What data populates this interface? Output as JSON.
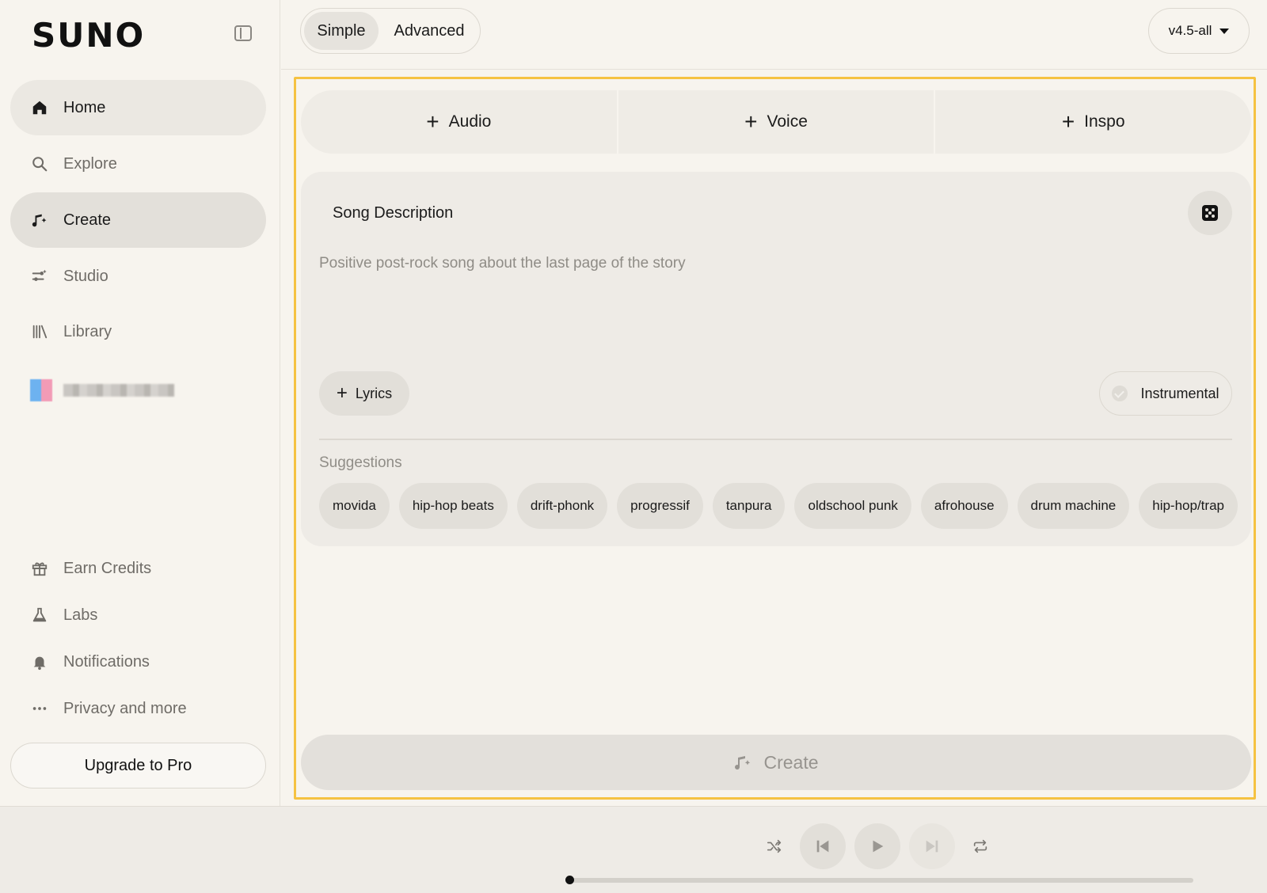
{
  "brand": {
    "logo": "SUNO"
  },
  "sidebar": {
    "items": [
      {
        "label": "Home",
        "icon": "home-icon"
      },
      {
        "label": "Explore",
        "icon": "search-icon"
      },
      {
        "label": "Create",
        "icon": "music-note-sparkle-icon"
      },
      {
        "label": "Studio",
        "icon": "studio-sliders-icon"
      },
      {
        "label": "Library",
        "icon": "library-icon"
      }
    ],
    "bottom_items": [
      {
        "label": "Earn Credits",
        "icon": "gift-icon"
      },
      {
        "label": "Labs",
        "icon": "flask-icon"
      },
      {
        "label": "Notifications",
        "icon": "bell-icon"
      },
      {
        "label": "Privacy and more",
        "icon": "more-dots-icon"
      }
    ],
    "upgrade_label": "Upgrade to Pro"
  },
  "topbar": {
    "mode_simple": "Simple",
    "mode_advanced": "Advanced",
    "active_mode": "Simple",
    "version": "v4.5-all"
  },
  "create_panel": {
    "add_audio": "Audio",
    "add_voice": "Voice",
    "add_inspo": "Inspo",
    "description_label": "Song Description",
    "description_placeholder": "Positive post-rock song about the last page of the story",
    "lyrics_label": "Lyrics",
    "instrumental_label": "Instrumental",
    "suggestions_label": "Suggestions",
    "suggestions": [
      "movida",
      "hip-hop beats",
      "drift-phonk",
      "progressif",
      "tanpura",
      "oldschool punk",
      "afrohouse",
      "drum machine",
      "hip-hop/trap"
    ],
    "create_label": "Create"
  },
  "player": {
    "progress": 0
  },
  "colors": {
    "highlight_border": "#f5c242",
    "background": "#f7f4ee"
  }
}
